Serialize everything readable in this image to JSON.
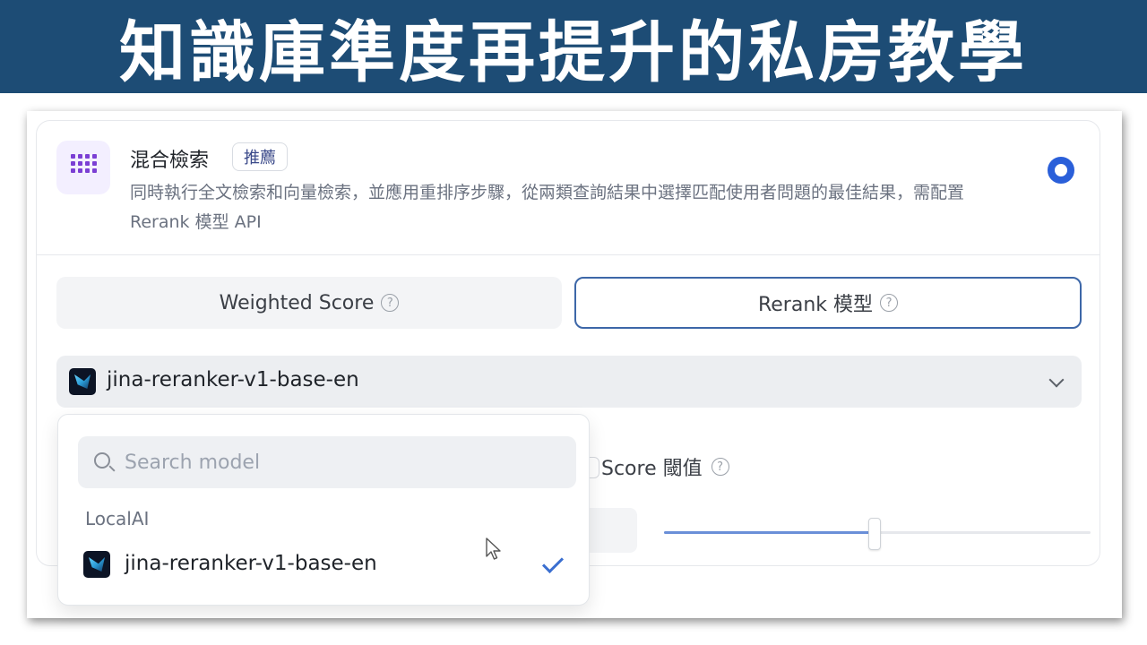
{
  "banner": {
    "title": "知識庫準度再提升的私房教學"
  },
  "retrieval_card": {
    "title": "混合檢索",
    "badge": "推薦",
    "description": "同時執行全文檢索和向量檢索，並應用重排序步驟，從兩類查詢結果中選擇匹配使用者問題的最佳結果，需配置 Rerank 模型 API",
    "icon": "grid-dots-icon",
    "selected": true,
    "accent_color": "#2a5fd9"
  },
  "mode_tabs": [
    {
      "label": "Weighted Score",
      "help": "?",
      "active": false
    },
    {
      "label": "Rerank 模型",
      "help": "?",
      "active": true
    }
  ],
  "model_select": {
    "value": "jina-reranker-v1-base-en"
  },
  "score_threshold": {
    "label": "Score 閾值",
    "help": "?",
    "slider_fraction": 0.5
  },
  "dropdown": {
    "search_placeholder": "Search model",
    "group": "LocalAI",
    "options": [
      {
        "label": "jina-reranker-v1-base-en",
        "selected": true
      }
    ]
  }
}
